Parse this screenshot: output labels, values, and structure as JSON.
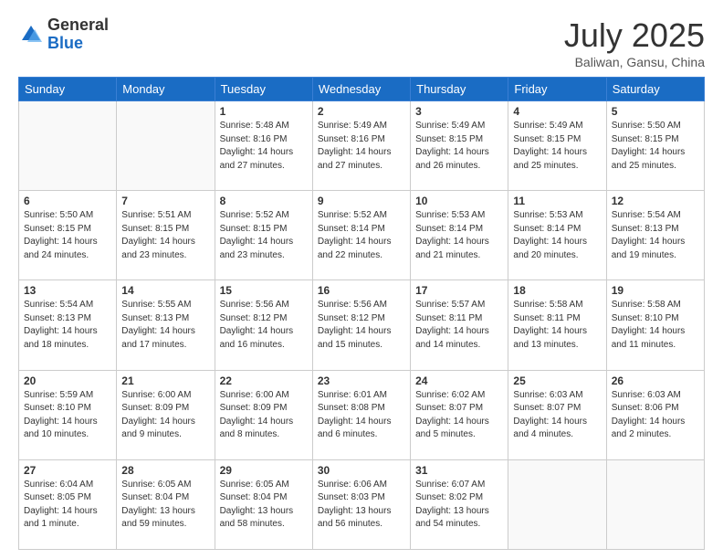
{
  "header": {
    "logo_general": "General",
    "logo_blue": "Blue",
    "month_title": "July 2025",
    "subtitle": "Baliwan, Gansu, China"
  },
  "days_of_week": [
    "Sunday",
    "Monday",
    "Tuesday",
    "Wednesday",
    "Thursday",
    "Friday",
    "Saturday"
  ],
  "weeks": [
    [
      {
        "day": "",
        "sunrise": "",
        "sunset": "",
        "daylight": ""
      },
      {
        "day": "",
        "sunrise": "",
        "sunset": "",
        "daylight": ""
      },
      {
        "day": "1",
        "sunrise": "Sunrise: 5:48 AM",
        "sunset": "Sunset: 8:16 PM",
        "daylight": "Daylight: 14 hours and 27 minutes."
      },
      {
        "day": "2",
        "sunrise": "Sunrise: 5:49 AM",
        "sunset": "Sunset: 8:16 PM",
        "daylight": "Daylight: 14 hours and 27 minutes."
      },
      {
        "day": "3",
        "sunrise": "Sunrise: 5:49 AM",
        "sunset": "Sunset: 8:15 PM",
        "daylight": "Daylight: 14 hours and 26 minutes."
      },
      {
        "day": "4",
        "sunrise": "Sunrise: 5:49 AM",
        "sunset": "Sunset: 8:15 PM",
        "daylight": "Daylight: 14 hours and 25 minutes."
      },
      {
        "day": "5",
        "sunrise": "Sunrise: 5:50 AM",
        "sunset": "Sunset: 8:15 PM",
        "daylight": "Daylight: 14 hours and 25 minutes."
      }
    ],
    [
      {
        "day": "6",
        "sunrise": "Sunrise: 5:50 AM",
        "sunset": "Sunset: 8:15 PM",
        "daylight": "Daylight: 14 hours and 24 minutes."
      },
      {
        "day": "7",
        "sunrise": "Sunrise: 5:51 AM",
        "sunset": "Sunset: 8:15 PM",
        "daylight": "Daylight: 14 hours and 23 minutes."
      },
      {
        "day": "8",
        "sunrise": "Sunrise: 5:52 AM",
        "sunset": "Sunset: 8:15 PM",
        "daylight": "Daylight: 14 hours and 23 minutes."
      },
      {
        "day": "9",
        "sunrise": "Sunrise: 5:52 AM",
        "sunset": "Sunset: 8:14 PM",
        "daylight": "Daylight: 14 hours and 22 minutes."
      },
      {
        "day": "10",
        "sunrise": "Sunrise: 5:53 AM",
        "sunset": "Sunset: 8:14 PM",
        "daylight": "Daylight: 14 hours and 21 minutes."
      },
      {
        "day": "11",
        "sunrise": "Sunrise: 5:53 AM",
        "sunset": "Sunset: 8:14 PM",
        "daylight": "Daylight: 14 hours and 20 minutes."
      },
      {
        "day": "12",
        "sunrise": "Sunrise: 5:54 AM",
        "sunset": "Sunset: 8:13 PM",
        "daylight": "Daylight: 14 hours and 19 minutes."
      }
    ],
    [
      {
        "day": "13",
        "sunrise": "Sunrise: 5:54 AM",
        "sunset": "Sunset: 8:13 PM",
        "daylight": "Daylight: 14 hours and 18 minutes."
      },
      {
        "day": "14",
        "sunrise": "Sunrise: 5:55 AM",
        "sunset": "Sunset: 8:13 PM",
        "daylight": "Daylight: 14 hours and 17 minutes."
      },
      {
        "day": "15",
        "sunrise": "Sunrise: 5:56 AM",
        "sunset": "Sunset: 8:12 PM",
        "daylight": "Daylight: 14 hours and 16 minutes."
      },
      {
        "day": "16",
        "sunrise": "Sunrise: 5:56 AM",
        "sunset": "Sunset: 8:12 PM",
        "daylight": "Daylight: 14 hours and 15 minutes."
      },
      {
        "day": "17",
        "sunrise": "Sunrise: 5:57 AM",
        "sunset": "Sunset: 8:11 PM",
        "daylight": "Daylight: 14 hours and 14 minutes."
      },
      {
        "day": "18",
        "sunrise": "Sunrise: 5:58 AM",
        "sunset": "Sunset: 8:11 PM",
        "daylight": "Daylight: 14 hours and 13 minutes."
      },
      {
        "day": "19",
        "sunrise": "Sunrise: 5:58 AM",
        "sunset": "Sunset: 8:10 PM",
        "daylight": "Daylight: 14 hours and 11 minutes."
      }
    ],
    [
      {
        "day": "20",
        "sunrise": "Sunrise: 5:59 AM",
        "sunset": "Sunset: 8:10 PM",
        "daylight": "Daylight: 14 hours and 10 minutes."
      },
      {
        "day": "21",
        "sunrise": "Sunrise: 6:00 AM",
        "sunset": "Sunset: 8:09 PM",
        "daylight": "Daylight: 14 hours and 9 minutes."
      },
      {
        "day": "22",
        "sunrise": "Sunrise: 6:00 AM",
        "sunset": "Sunset: 8:09 PM",
        "daylight": "Daylight: 14 hours and 8 minutes."
      },
      {
        "day": "23",
        "sunrise": "Sunrise: 6:01 AM",
        "sunset": "Sunset: 8:08 PM",
        "daylight": "Daylight: 14 hours and 6 minutes."
      },
      {
        "day": "24",
        "sunrise": "Sunrise: 6:02 AM",
        "sunset": "Sunset: 8:07 PM",
        "daylight": "Daylight: 14 hours and 5 minutes."
      },
      {
        "day": "25",
        "sunrise": "Sunrise: 6:03 AM",
        "sunset": "Sunset: 8:07 PM",
        "daylight": "Daylight: 14 hours and 4 minutes."
      },
      {
        "day": "26",
        "sunrise": "Sunrise: 6:03 AM",
        "sunset": "Sunset: 8:06 PM",
        "daylight": "Daylight: 14 hours and 2 minutes."
      }
    ],
    [
      {
        "day": "27",
        "sunrise": "Sunrise: 6:04 AM",
        "sunset": "Sunset: 8:05 PM",
        "daylight": "Daylight: 14 hours and 1 minute."
      },
      {
        "day": "28",
        "sunrise": "Sunrise: 6:05 AM",
        "sunset": "Sunset: 8:04 PM",
        "daylight": "Daylight: 13 hours and 59 minutes."
      },
      {
        "day": "29",
        "sunrise": "Sunrise: 6:05 AM",
        "sunset": "Sunset: 8:04 PM",
        "daylight": "Daylight: 13 hours and 58 minutes."
      },
      {
        "day": "30",
        "sunrise": "Sunrise: 6:06 AM",
        "sunset": "Sunset: 8:03 PM",
        "daylight": "Daylight: 13 hours and 56 minutes."
      },
      {
        "day": "31",
        "sunrise": "Sunrise: 6:07 AM",
        "sunset": "Sunset: 8:02 PM",
        "daylight": "Daylight: 13 hours and 54 minutes."
      },
      {
        "day": "",
        "sunrise": "",
        "sunset": "",
        "daylight": ""
      },
      {
        "day": "",
        "sunrise": "",
        "sunset": "",
        "daylight": ""
      }
    ]
  ]
}
